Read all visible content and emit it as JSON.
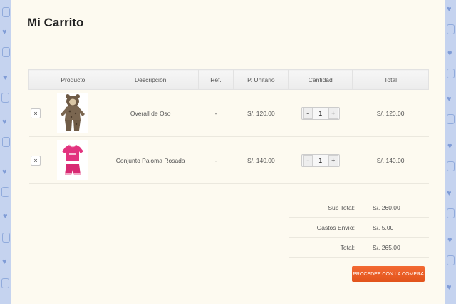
{
  "page": {
    "title": "Mi Carrito"
  },
  "cart": {
    "headers": [
      "",
      "Producto",
      "Descripción",
      "Ref.",
      "P. Unitario",
      "Cantidad",
      "Total"
    ],
    "items": [
      {
        "remove": "×",
        "image": "overall-oso-image",
        "description": "Overall de Oso",
        "ref": "-",
        "unit_price": "S/. 120.00",
        "qty": "1",
        "total": "S/. 120.00"
      },
      {
        "remove": "×",
        "image": "conjunto-paloma-image",
        "description": "Conjunto Paloma Rosada",
        "ref": "-",
        "unit_price": "S/. 140.00",
        "qty": "1",
        "total": "S/. 140.00"
      }
    ],
    "qty_minus": "-",
    "qty_plus": "+"
  },
  "totals": {
    "subtotal_label": "Sub Total:",
    "subtotal": "S/. 260.00",
    "shipping_label": "Gastos Envío:",
    "shipping": "S/. 5.00",
    "total_label": "Total:",
    "total": "S/. 265.00"
  },
  "checkout": {
    "label": "PROCEDEE CON LA COMPRA"
  },
  "colors": {
    "accent": "#e9591f",
    "background": "#fdfaf0",
    "side_pattern": "#c3d2ee"
  }
}
